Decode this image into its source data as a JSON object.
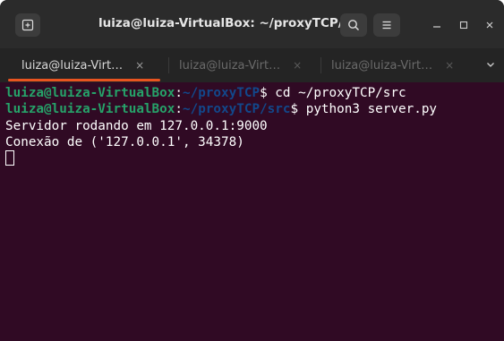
{
  "window": {
    "title": "luiza@luiza-VirtualBox: ~/proxyTCP/src"
  },
  "titlebar": {
    "new_tab_icon": "new-tab-icon",
    "search_icon": "search-icon",
    "menu_icon": "hamburger-menu-icon",
    "minimize_icon": "minimize-icon",
    "maximize_icon": "maximize-icon",
    "close_icon": "close-icon"
  },
  "tabs": [
    {
      "label": "luiza@luiza-Virt…",
      "active": true
    },
    {
      "label": "luiza@luiza-Virt…",
      "active": false
    },
    {
      "label": "luiza@luiza-Virt…",
      "active": false
    }
  ],
  "tab_close_glyph": "×",
  "colors": {
    "terminal_bg": "#300a24",
    "prompt_user": "#26a269",
    "prompt_path": "#12488b",
    "accent": "#e95420"
  },
  "terminal": {
    "lines": [
      {
        "user": "luiza@luiza-VirtualBox",
        "colon": ":",
        "path": "~/proxyTCP",
        "dollar": "$",
        "command": " cd ~/proxyTCP/src"
      },
      {
        "user": "luiza@luiza-VirtualBox",
        "colon": ":",
        "path": "~/proxyTCP/src",
        "dollar": "$",
        "command": " python3 server.py"
      }
    ],
    "output": [
      "Servidor rodando em 127.0.0.1:9000",
      "Conexão de ('127.0.0.1', 34378)"
    ]
  }
}
